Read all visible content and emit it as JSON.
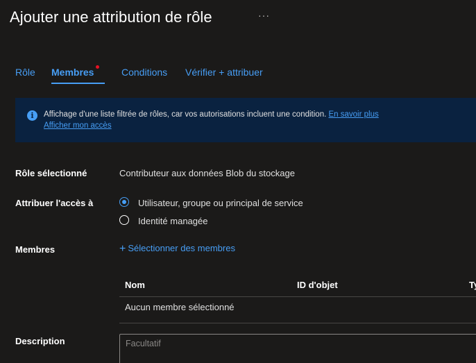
{
  "header": {
    "title": "Ajouter une attribution de rôle",
    "more_label": "···"
  },
  "tabs": [
    {
      "label": "Rôle"
    },
    {
      "label": "Membres"
    },
    {
      "label": "Conditions"
    },
    {
      "label": "Vérifier + attribuer"
    }
  ],
  "active_tab": "Membres",
  "banner": {
    "icon": "info-icon",
    "message": "Affichage d'une liste filtrée de rôles, car vos autorisations incluent une condition.",
    "learn_more": "En savoir plus",
    "show_access": "Afficher mon accès"
  },
  "form": {
    "role_label": "Rôle sélectionné",
    "role_value": "Contributeur aux données Blob du stockage",
    "assign_label": "Attribuer l'accès à",
    "options": [
      {
        "label": "Utilisateur, groupe ou principal de service",
        "checked": true
      },
      {
        "label": "Identité managée",
        "checked": false
      }
    ],
    "members_label": "Membres",
    "select_members": "Sélectionner des membres",
    "table": {
      "columns": [
        "Nom",
        "ID d'objet",
        "Ty"
      ],
      "empty_text": "Aucun membre sélectionné"
    },
    "description_label": "Description",
    "description_placeholder": "Facultatif"
  },
  "colors": {
    "accent": "#479ef5",
    "banner_bg": "#0a2240",
    "background": "#1b1a19",
    "notification_dot": "#e81123"
  }
}
